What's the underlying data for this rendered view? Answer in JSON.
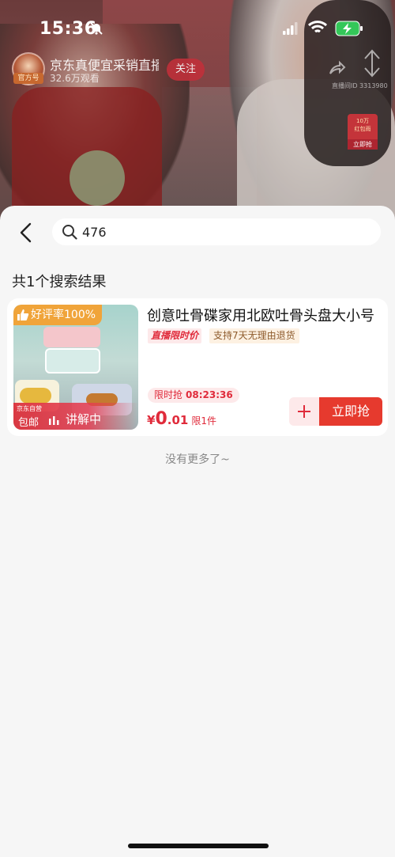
{
  "status_bar": {
    "time": "15:36"
  },
  "live": {
    "streamer_name": "京东真便宜采销直播",
    "streamer_tag": "官方号",
    "viewers": "32.6万观看",
    "follow_label": "关注",
    "room_id": "直播间ID 3313980",
    "red_packet": {
      "amount": "10万",
      "subtitle": "红包雨",
      "grab": "立即抢"
    }
  },
  "search": {
    "query": "476",
    "placeholder": ""
  },
  "results": {
    "count_label": "共1个搜索结果"
  },
  "products": [
    {
      "rating_badge": "好评率100%",
      "store_tag": "京东自营",
      "free_shipping": "包邮",
      "live_status": "讲解中",
      "title": "创意吐骨碟家用北欧吐骨头盘大小号",
      "tag_live_price": "直播限时价",
      "tag_return": "支持7天无理由退货",
      "flash_label": "限时抢",
      "countdown": "08:23:36",
      "price_currency": "¥",
      "price_int": "0",
      "price_dec": ".01",
      "limit": "限1件",
      "buy_label": "立即抢"
    }
  ],
  "footer": {
    "no_more": "没有更多了~"
  },
  "colors": {
    "accent": "#e63a2e",
    "tag_bg": "#fde9ea",
    "badge_orange": "#f0a43a"
  }
}
